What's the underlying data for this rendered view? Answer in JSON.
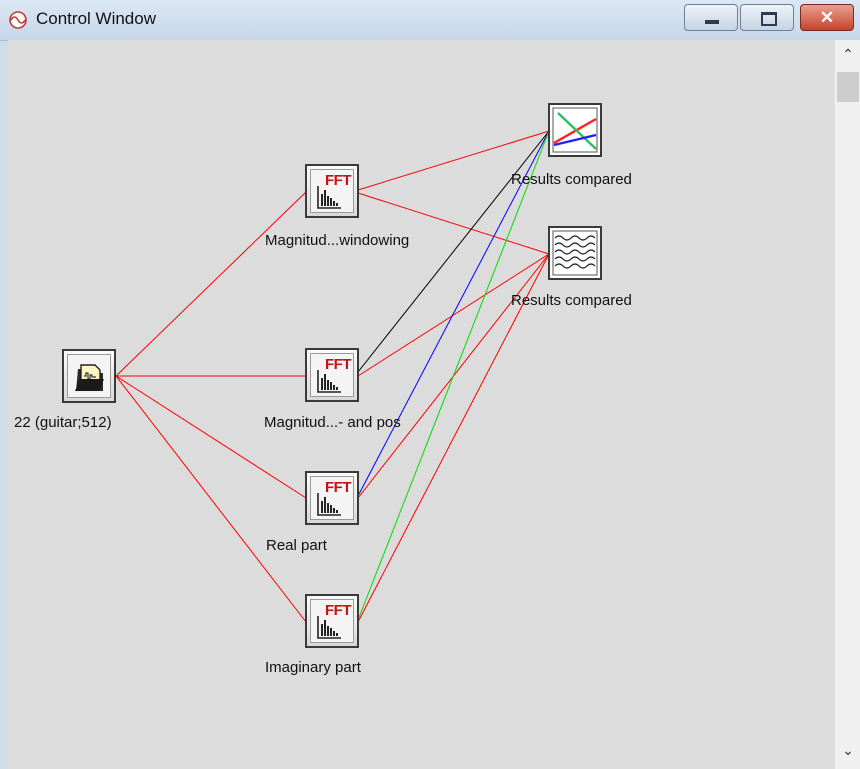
{
  "window": {
    "title": "Control Window"
  },
  "nodes": {
    "source": {
      "label": "22 (guitar;512)",
      "icon": "file-source-icon"
    },
    "fft_windowing": {
      "label": "Magnitud...windowing",
      "badge": "FFT"
    },
    "fft_negpos": {
      "label": "Magnitud...- and pos",
      "badge": "FFT"
    },
    "fft_real": {
      "label": "Real part",
      "badge": "FFT"
    },
    "fft_imag": {
      "label": "Imaginary part",
      "badge": "FFT"
    },
    "plot_graph": {
      "label": "Results compared",
      "icon": "xy-plot-icon"
    },
    "plot_wave": {
      "label": "Results compared",
      "icon": "waveform-icon"
    }
  },
  "edge_colors": {
    "default": "#ff0000",
    "black": "#000000",
    "blue": "#0000ff",
    "green": "#00dd00"
  }
}
